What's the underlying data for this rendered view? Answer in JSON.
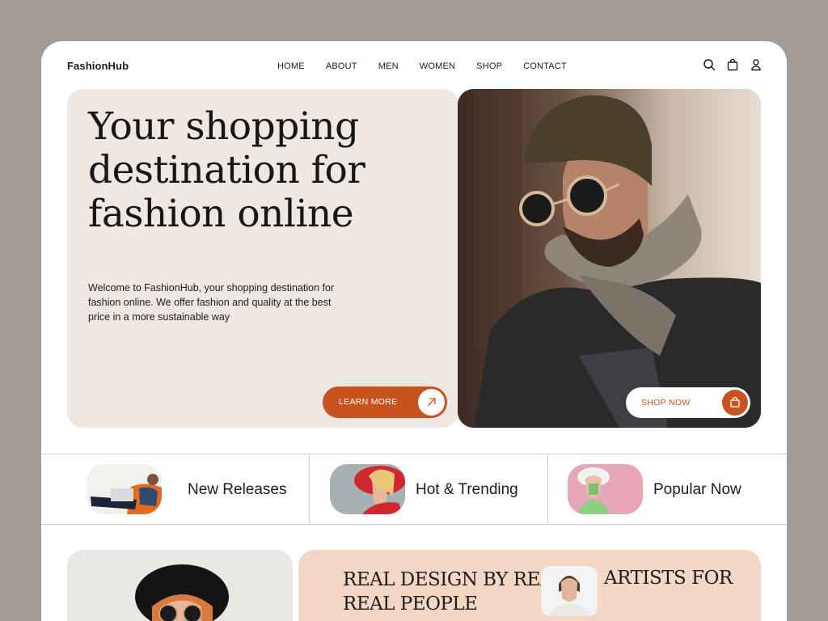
{
  "brand": "FashionHub",
  "nav": [
    "HOME",
    "ABOUT",
    "MEN",
    "WOMEN",
    "SHOP",
    "CONTACT"
  ],
  "icons": [
    "search-icon",
    "bag-icon",
    "user-icon"
  ],
  "hero": {
    "title": "Your shopping destination for fashion online",
    "description": "Welcome to FashionHub, your shopping destination for fashion online. We offer fashion and quality at the best price in a more sustainable way",
    "learn_more": "LEARN MORE",
    "shop_now": "SHOP NOW"
  },
  "categories": [
    "New Releases",
    "Hot & Trending",
    "Popular Now"
  ],
  "banner": {
    "line1": "REAL DESIGN BY REAL",
    "line2": "REAL PEOPLE",
    "line3": "ARTISTS FOR"
  },
  "colors": {
    "accent": "#c8531e",
    "hero_bg": "#efe7e2",
    "banner_bg": "#f3d6c4",
    "page_bg": "#a29b96"
  }
}
